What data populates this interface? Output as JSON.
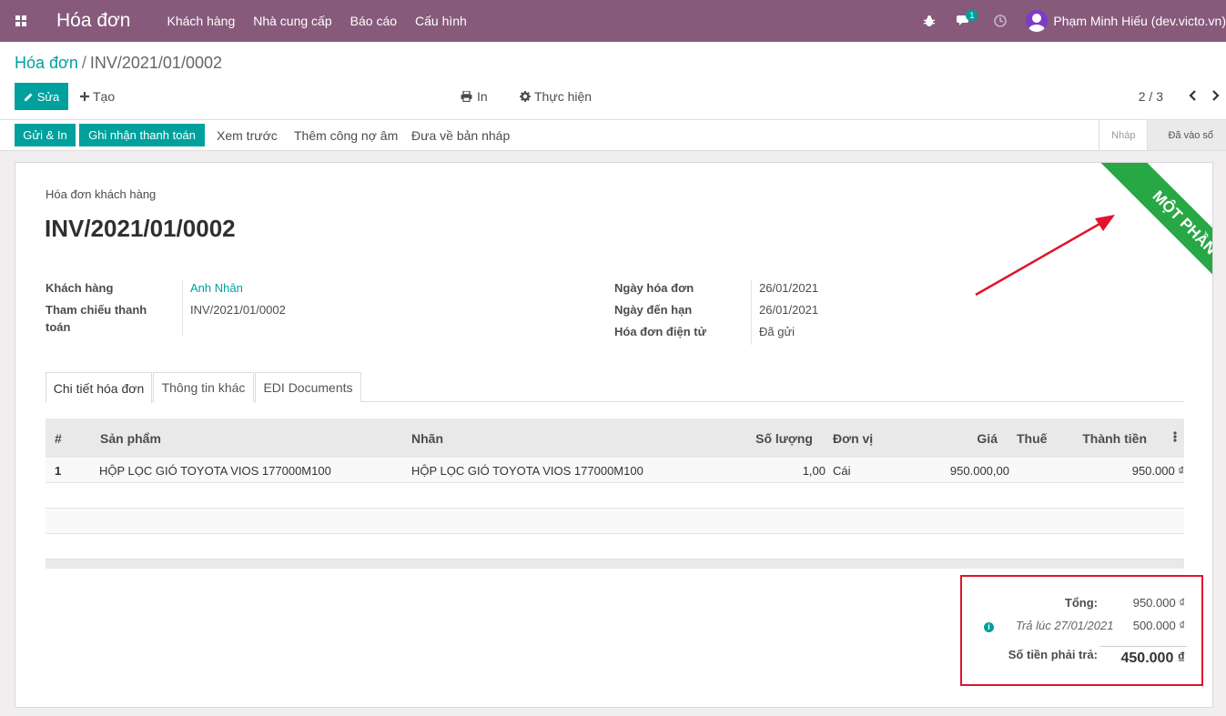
{
  "navbar": {
    "app_title": "Hóa đơn",
    "menu": [
      "Khách hàng",
      "Nhà cung cấp",
      "Báo cáo",
      "Cấu hình"
    ],
    "messages_count": "1",
    "user_name": "Phạm Minh Hiếu (dev.victo.vn)",
    "icons": [
      "apps-icon",
      "bug-icon",
      "chat-icon",
      "clock-icon",
      "avatar"
    ]
  },
  "breadcrumb": {
    "parent": "Hóa đơn",
    "separator": "/",
    "current": "INV/2021/01/0002"
  },
  "toolbar": {
    "edit_label": "Sửa",
    "create_label": "Tạo",
    "print_label": "In",
    "action_label": "Thực hiện",
    "pager": "2 / 3"
  },
  "statusbar": {
    "buttons": [
      "Gửi & In",
      "Ghi nhận thanh toán",
      "Xem trước",
      "Thêm công nợ âm",
      "Đưa về bản nháp"
    ],
    "stages": [
      "Nháp",
      "Đã vào sổ"
    ],
    "active_stage": "Đã vào sổ"
  },
  "form": {
    "ribbon": "MỘT PHẦN",
    "subtitle": "Hóa đơn khách hàng",
    "title": "INV/2021/01/0002",
    "left_fields": [
      {
        "label": "Khách hàng",
        "value": "Anh Nhân"
      },
      {
        "label": "Tham chiếu thanh toán",
        "value": "INV/2021/01/0002"
      }
    ],
    "right_fields": [
      {
        "label": "Ngày hóa đơn",
        "value": "26/01/2021"
      },
      {
        "label": "Ngày đến hạn",
        "value": "26/01/2021"
      },
      {
        "label": "Hóa đơn điện tử",
        "value": "Đã gửi"
      }
    ],
    "tabs": [
      "Chi tiết hóa đơn",
      "Thông tin khác",
      "EDI Documents"
    ],
    "active_tab": "Chi tiết hóa đơn"
  },
  "lines": {
    "headers": [
      "#",
      "Sản phẩm",
      "Nhãn",
      "Số lượng",
      "Đơn vị",
      "Giá",
      "Thuế",
      "Thành tiền"
    ],
    "rows": [
      {
        "no": "1",
        "product": "HỘP LỌC GIÓ TOYOTA VIOS 177000M100",
        "label": "HỘP LỌC GIÓ TOYOTA VIOS 177000M100",
        "qty": "1,00",
        "uom": "Cái",
        "price": "950.000,00",
        "tax": "",
        "subtotal": "950.000 ₫"
      }
    ]
  },
  "totals": {
    "total_label": "Tổng:",
    "total_value": "950.000 ₫",
    "paid_label": "Trả lúc 27/01/2021",
    "paid_value": "500.000 ₫",
    "due_label": "Số tiền phải trả:",
    "due_value": "450.000 ₫"
  },
  "colors": {
    "navbar": "#875a7b",
    "primary": "#00a09d",
    "ribbon": "#28a745",
    "highlight": "#e0142c"
  }
}
